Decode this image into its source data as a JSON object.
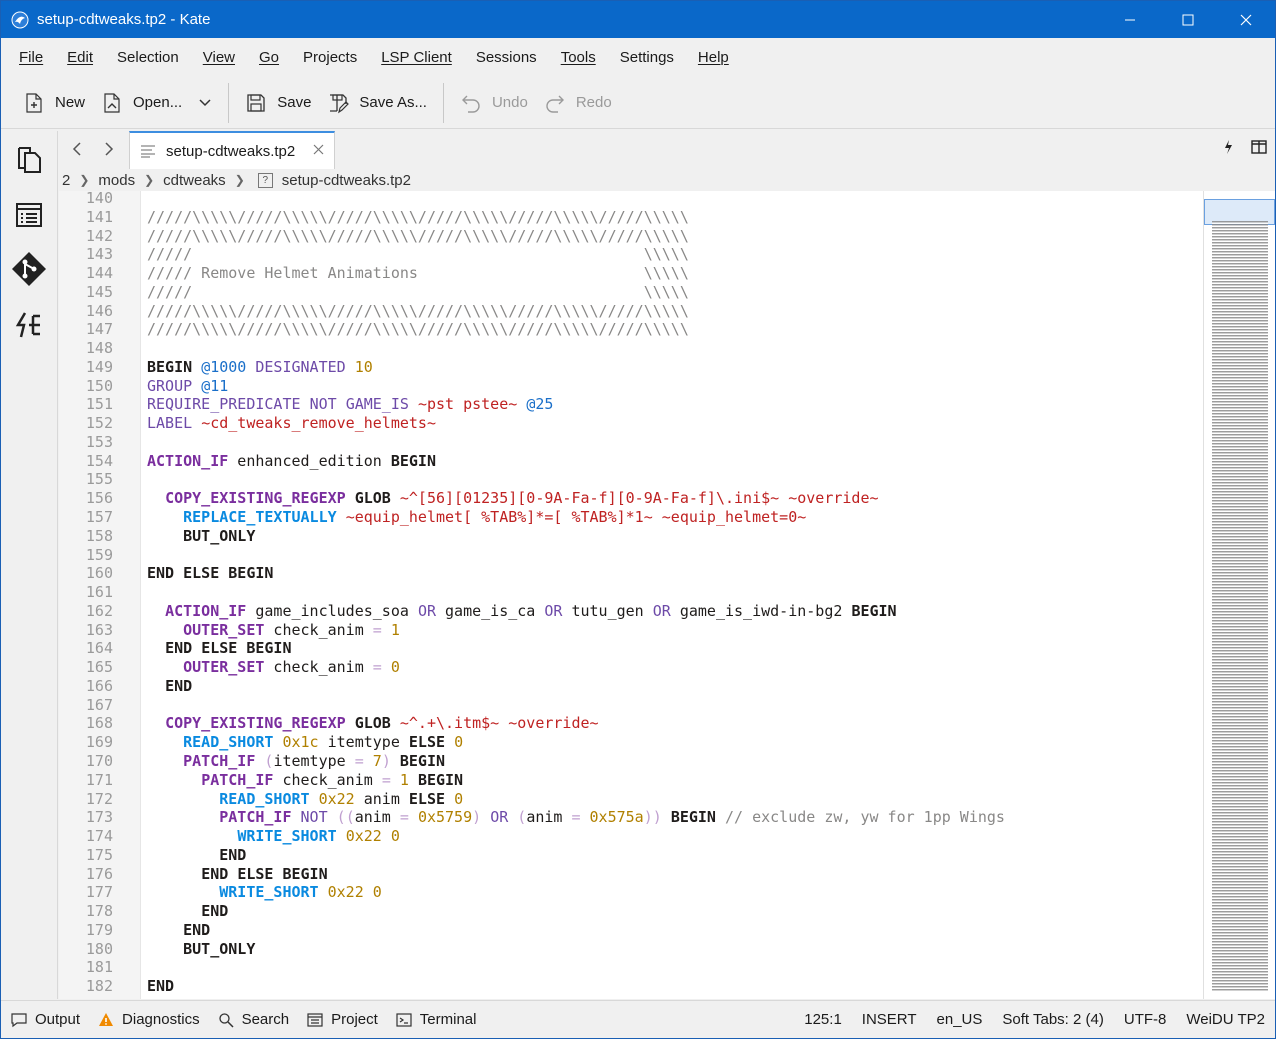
{
  "window": {
    "title": "setup-cdtweaks.tp2  -  Kate"
  },
  "menu": [
    "File",
    "Edit",
    "Selection",
    "View",
    "Go",
    "Projects",
    "LSP Client",
    "Sessions",
    "Tools",
    "Settings",
    "Help"
  ],
  "toolbar": {
    "new": "New",
    "open": "Open...",
    "save": "Save",
    "save_as": "Save As...",
    "undo": "Undo",
    "redo": "Redo"
  },
  "tab": {
    "label": "setup-cdtweaks.tp2"
  },
  "breadcrumb": {
    "root": "2",
    "dir1": "mods",
    "dir2": "cdtweaks",
    "file": "setup-cdtweaks.tp2"
  },
  "statusbar": {
    "output": "Output",
    "diagnostics": "Diagnostics",
    "search": "Search",
    "project": "Project",
    "terminal": "Terminal",
    "cursor": "125:1",
    "mode": "INSERT",
    "dictionary": "en_US",
    "indent": "Soft Tabs: 2 (4)",
    "encoding": "UTF-8",
    "syntax": "WeiDU TP2"
  },
  "editor": {
    "lines": [
      {
        "n": "140",
        "t": ""
      },
      {
        "n": "141",
        "t": "/////\\\\\\\\\\/////\\\\\\\\\\/////\\\\\\\\\\/////\\\\\\\\\\/////\\\\\\\\\\/////\\\\\\\\\\"
      },
      {
        "n": "142",
        "t": "/////\\\\\\\\\\/////\\\\\\\\\\/////\\\\\\\\\\/////\\\\\\\\\\/////\\\\\\\\\\/////\\\\\\\\\\"
      },
      {
        "n": "143",
        "t": "/////                                                  \\\\\\\\\\"
      },
      {
        "n": "144",
        "t": "///// Remove Helmet Animations                         \\\\\\\\\\"
      },
      {
        "n": "145",
        "t": "/////                                                  \\\\\\\\\\"
      },
      {
        "n": "146",
        "t": "/////\\\\\\\\\\/////\\\\\\\\\\/////\\\\\\\\\\/////\\\\\\\\\\/////\\\\\\\\\\/////\\\\\\\\\\"
      },
      {
        "n": "147",
        "t": "/////\\\\\\\\\\/////\\\\\\\\\\/////\\\\\\\\\\/////\\\\\\\\\\/////\\\\\\\\\\/////\\\\\\\\\\"
      },
      {
        "n": "148",
        "t": ""
      },
      {
        "n": "149",
        "t": "BEGIN @1000 DESIGNATED 10"
      },
      {
        "n": "150",
        "t": "GROUP @11"
      },
      {
        "n": "151",
        "t": "REQUIRE_PREDICATE NOT GAME_IS ~pst pstee~ @25"
      },
      {
        "n": "152",
        "t": "LABEL ~cd_tweaks_remove_helmets~"
      },
      {
        "n": "153",
        "t": ""
      },
      {
        "n": "154",
        "t": "ACTION_IF enhanced_edition BEGIN"
      },
      {
        "n": "155",
        "t": ""
      },
      {
        "n": "156",
        "t": "  COPY_EXISTING_REGEXP GLOB ~^[56][01235][0-9A-Fa-f][0-9A-Fa-f]\\.ini$~ ~override~"
      },
      {
        "n": "157",
        "t": "    REPLACE_TEXTUALLY ~equip_helmet[ %TAB%]*=[ %TAB%]*1~ ~equip_helmet=0~"
      },
      {
        "n": "158",
        "t": "    BUT_ONLY"
      },
      {
        "n": "159",
        "t": ""
      },
      {
        "n": "160",
        "t": "END ELSE BEGIN"
      },
      {
        "n": "161",
        "t": ""
      },
      {
        "n": "162",
        "t": "  ACTION_IF game_includes_soa OR game_is_ca OR tutu_gen OR game_is_iwd-in-bg2 BEGIN"
      },
      {
        "n": "163",
        "t": "    OUTER_SET check_anim = 1"
      },
      {
        "n": "164",
        "t": "  END ELSE BEGIN"
      },
      {
        "n": "165",
        "t": "    OUTER_SET check_anim = 0"
      },
      {
        "n": "166",
        "t": "  END"
      },
      {
        "n": "167",
        "t": ""
      },
      {
        "n": "168",
        "t": "  COPY_EXISTING_REGEXP GLOB ~^.+\\.itm$~ ~override~"
      },
      {
        "n": "169",
        "t": "    READ_SHORT 0x1c itemtype ELSE 0"
      },
      {
        "n": "170",
        "t": "    PATCH_IF (itemtype = 7) BEGIN"
      },
      {
        "n": "171",
        "t": "      PATCH_IF check_anim = 1 BEGIN"
      },
      {
        "n": "172",
        "t": "        READ_SHORT 0x22 anim ELSE 0"
      },
      {
        "n": "173",
        "t": "        PATCH_IF NOT ((anim = 0x5759) OR (anim = 0x575a)) BEGIN // exclude zw, yw for 1pp Wings"
      },
      {
        "n": "174",
        "t": "          WRITE_SHORT 0x22 0"
      },
      {
        "n": "175",
        "t": "        END"
      },
      {
        "n": "176",
        "t": "      END ELSE BEGIN"
      },
      {
        "n": "177",
        "t": "        WRITE_SHORT 0x22 0"
      },
      {
        "n": "178",
        "t": "      END"
      },
      {
        "n": "179",
        "t": "    END"
      },
      {
        "n": "180",
        "t": "    BUT_ONLY"
      },
      {
        "n": "181",
        "t": ""
      },
      {
        "n": "182",
        "t": "END"
      }
    ]
  }
}
